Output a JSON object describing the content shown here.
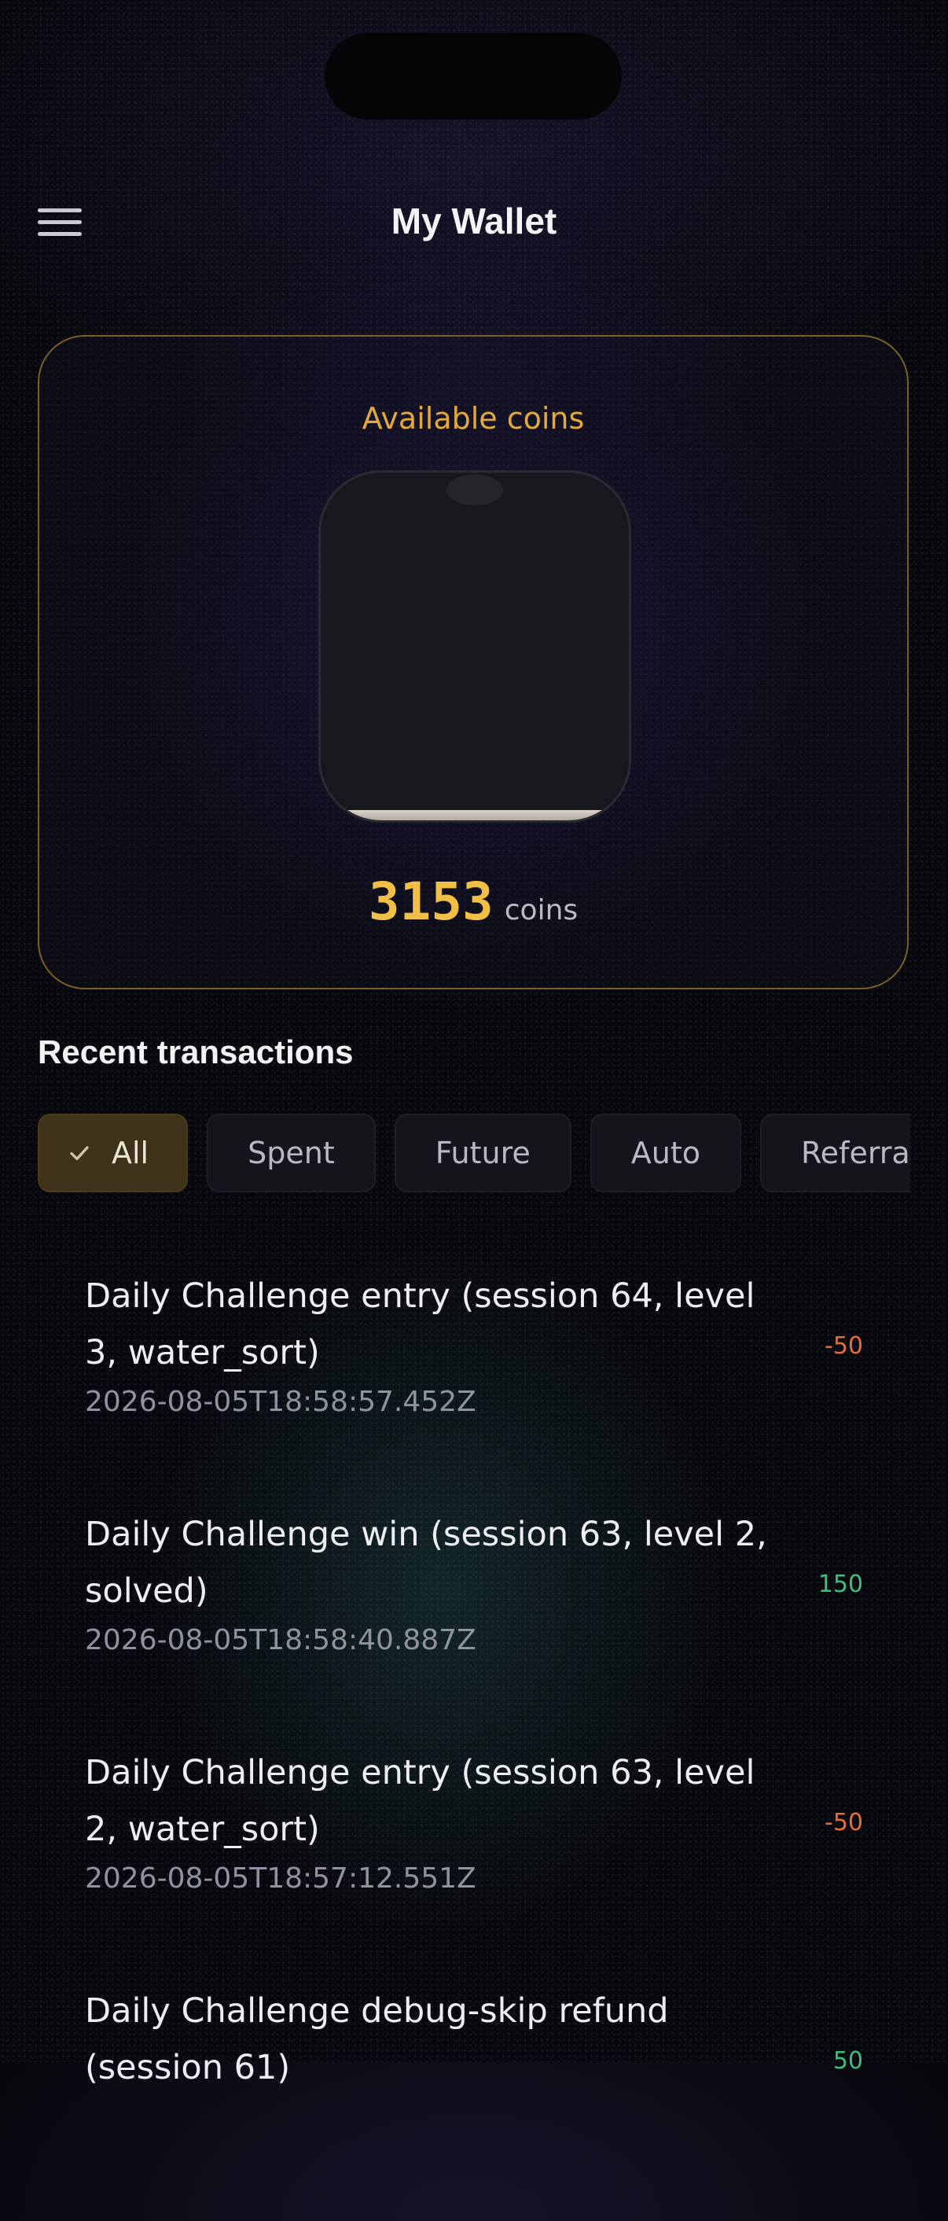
{
  "header": {
    "title": "My Wallet",
    "menu_icon": "hamburger-menu-icon"
  },
  "wallet": {
    "label": "Available coins",
    "balance": "3153",
    "unit": "coins",
    "fill_fraction": 0.03
  },
  "transactions": {
    "title": "Recent transactions",
    "filters": [
      {
        "label": "All",
        "selected": true
      },
      {
        "label": "Spent",
        "selected": false
      },
      {
        "label": "Future",
        "selected": false
      },
      {
        "label": "Auto",
        "selected": false
      },
      {
        "label": "Referral",
        "selected": false
      }
    ],
    "items": [
      {
        "description": "Daily Challenge entry (session 64, level 3, water_sort)",
        "timestamp": "2026-08-05T18:58:57.452Z",
        "amount": "-50",
        "type": "negative"
      },
      {
        "description": "Daily Challenge win (session 63, level 2, solved)",
        "timestamp": "2026-08-05T18:58:40.887Z",
        "amount": "150",
        "type": "positive"
      },
      {
        "description": "Daily Challenge entry (session 63, level 2, water_sort)",
        "timestamp": "2026-08-05T18:57:12.551Z",
        "amount": "-50",
        "type": "negative"
      },
      {
        "description": "Daily Challenge debug-skip refund (session 61)",
        "timestamp": "",
        "amount": "50",
        "type": "positive"
      }
    ]
  },
  "colors": {
    "accent": "#f2bf46",
    "negative": "#e86c3a",
    "positive": "#3fbf7a",
    "card_border": "#7a5f2a"
  }
}
